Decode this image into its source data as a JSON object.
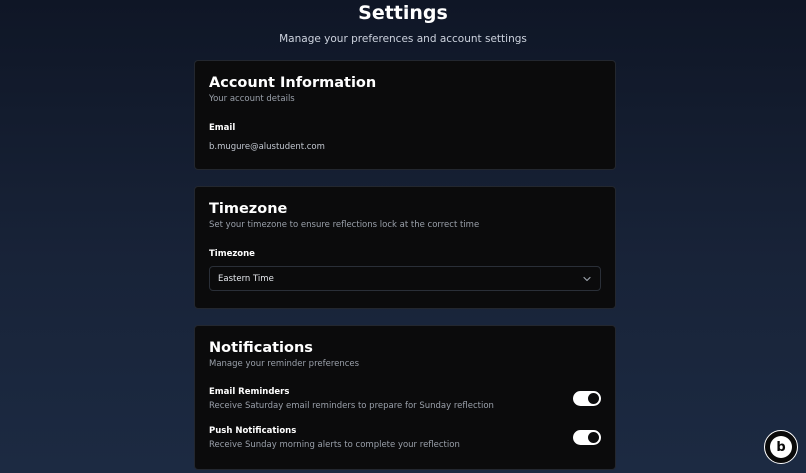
{
  "header": {
    "title": "Settings",
    "subtitle": "Manage your preferences and account settings"
  },
  "account": {
    "title": "Account Information",
    "description": "Your account details",
    "email_label": "Email",
    "email_value": "b.mugure@alustudent.com"
  },
  "timezone": {
    "title": "Timezone",
    "description": "Set your timezone to ensure reflections lock at the correct time",
    "field_label": "Timezone",
    "selected": "Eastern Time"
  },
  "notifications": {
    "title": "Notifications",
    "description": "Manage your reminder preferences",
    "items": [
      {
        "title": "Email Reminders",
        "description": "Receive Saturday email reminders to prepare for Sunday reflection",
        "enabled": true
      },
      {
        "title": "Push Notifications",
        "description": "Receive Sunday morning alerts to complete your reflection",
        "enabled": true
      }
    ]
  },
  "badge": {
    "letter": "b",
    "icon": "bolt-badge-icon"
  },
  "colors": {
    "card_bg": "#0b0b0c",
    "card_border": "#23272f",
    "toggle_on": "#ffffff",
    "muted_text": "#9aa0aa"
  }
}
